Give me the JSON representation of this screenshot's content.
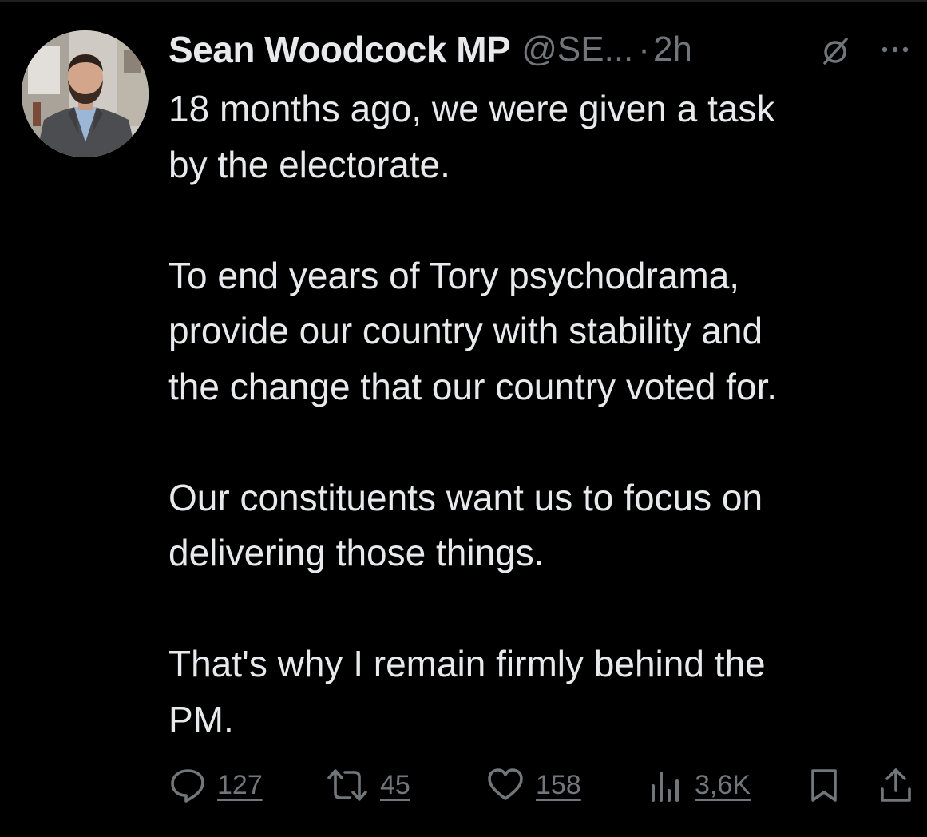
{
  "tweet": {
    "author": {
      "display_name": "Sean Woodcock MP",
      "handle": "@SE...",
      "separator": "·",
      "time": "2h"
    },
    "text": "18 months ago, we were given a task\nby the electorate.\n\nTo end years of Tory psychodrama,\nprovide our country with stability and\nthe change that our country voted for.\n\nOur constituents want us to focus on\ndelivering those things.\n\nThat's why I remain firmly behind the\nPM.",
    "icons": {
      "grok": "grok-icon",
      "more": "more-icon"
    },
    "actions": {
      "reply": {
        "icon": "reply-icon",
        "count": "127"
      },
      "repost": {
        "icon": "repost-icon",
        "count": "45"
      },
      "like": {
        "icon": "heart-icon",
        "count": "158"
      },
      "views": {
        "icon": "views-icon",
        "count": "3,6K"
      },
      "bookmark": {
        "icon": "bookmark-icon"
      },
      "share": {
        "icon": "share-icon"
      }
    }
  },
  "colors": {
    "background": "#000000",
    "primary_text": "#e7e9ea",
    "secondary_text": "#71767b"
  }
}
